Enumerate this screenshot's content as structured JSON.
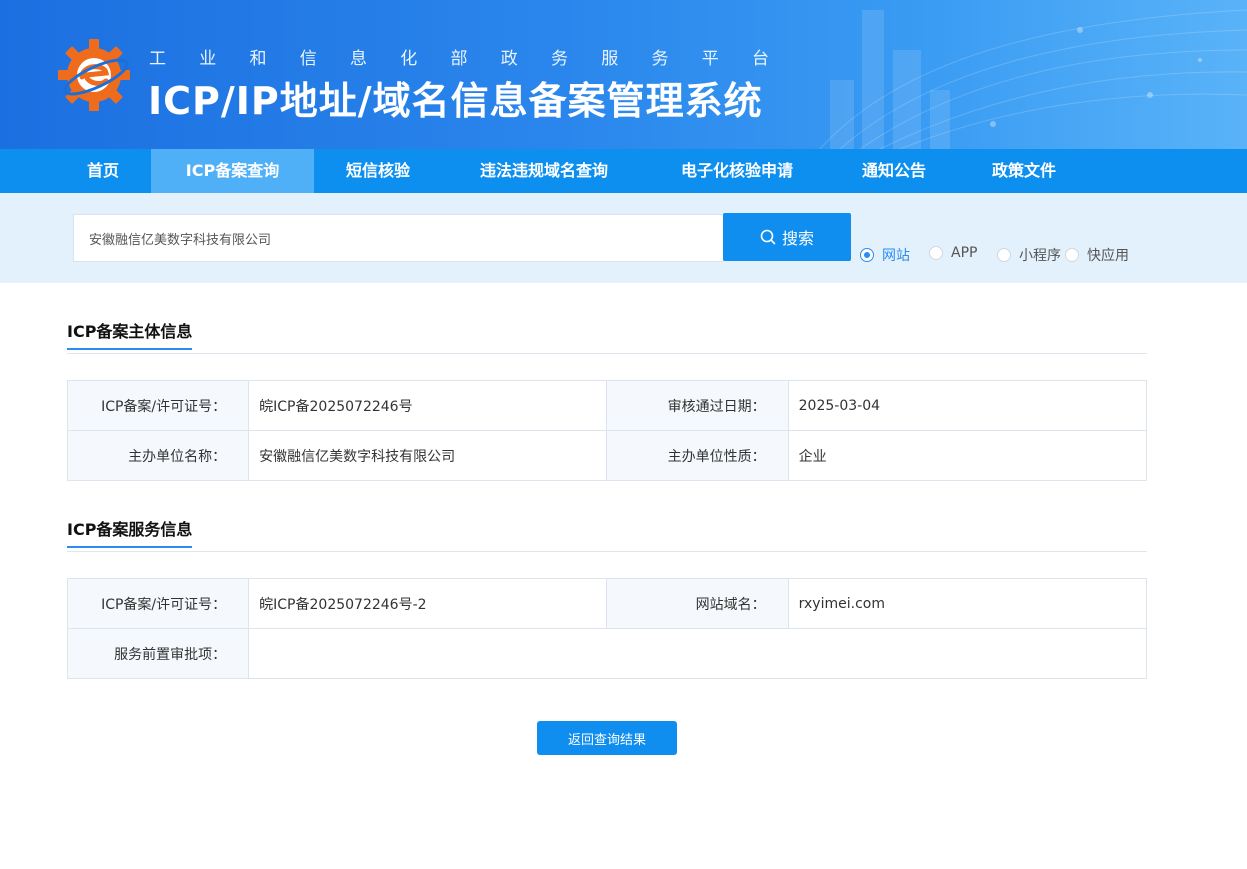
{
  "header": {
    "subtitle": "工业和信息化部政务服务平台",
    "title": "ICP/IP地址/域名信息备案管理系统"
  },
  "nav": {
    "items": [
      {
        "label": "首页"
      },
      {
        "label": "ICP备案查询",
        "active": true
      },
      {
        "label": "短信核验"
      },
      {
        "label": "违法违规域名查询"
      },
      {
        "label": "电子化核验申请"
      },
      {
        "label": "通知公告"
      },
      {
        "label": "政策文件"
      }
    ]
  },
  "search": {
    "value": "安徽融信亿美数字科技有限公司",
    "button_label": "搜索",
    "options": [
      {
        "label": "网站",
        "checked": true
      },
      {
        "label": "APP",
        "checked": false
      },
      {
        "label": "小程序",
        "checked": false
      },
      {
        "label": "快应用",
        "checked": false
      }
    ]
  },
  "subject": {
    "title": "ICP备案主体信息",
    "rows": [
      {
        "k1": "ICP备案/许可证号：",
        "v1": "皖ICP备2025072246号",
        "k2": "审核通过日期：",
        "v2": "2025-03-04"
      },
      {
        "k1": "主办单位名称：",
        "v1": "安徽融信亿美数字科技有限公司",
        "k2": "主办单位性质：",
        "v2": "企业"
      }
    ]
  },
  "service": {
    "title": "ICP备案服务信息",
    "rows": [
      {
        "k1": "ICP备案/许可证号：",
        "v1": "皖ICP备2025072246号-2",
        "k2": "网站域名：",
        "v2": "rxyimei.com"
      }
    ],
    "pre_approval_label": "服务前置审批项：",
    "pre_approval_value": ""
  },
  "back_button_label": "返回查询结果",
  "colors": {
    "primary": "#0f8ef0",
    "nav_bg": "#0d8ff0",
    "nav_active": "#4fb0f7",
    "logo_orange": "#ee6c1c"
  }
}
